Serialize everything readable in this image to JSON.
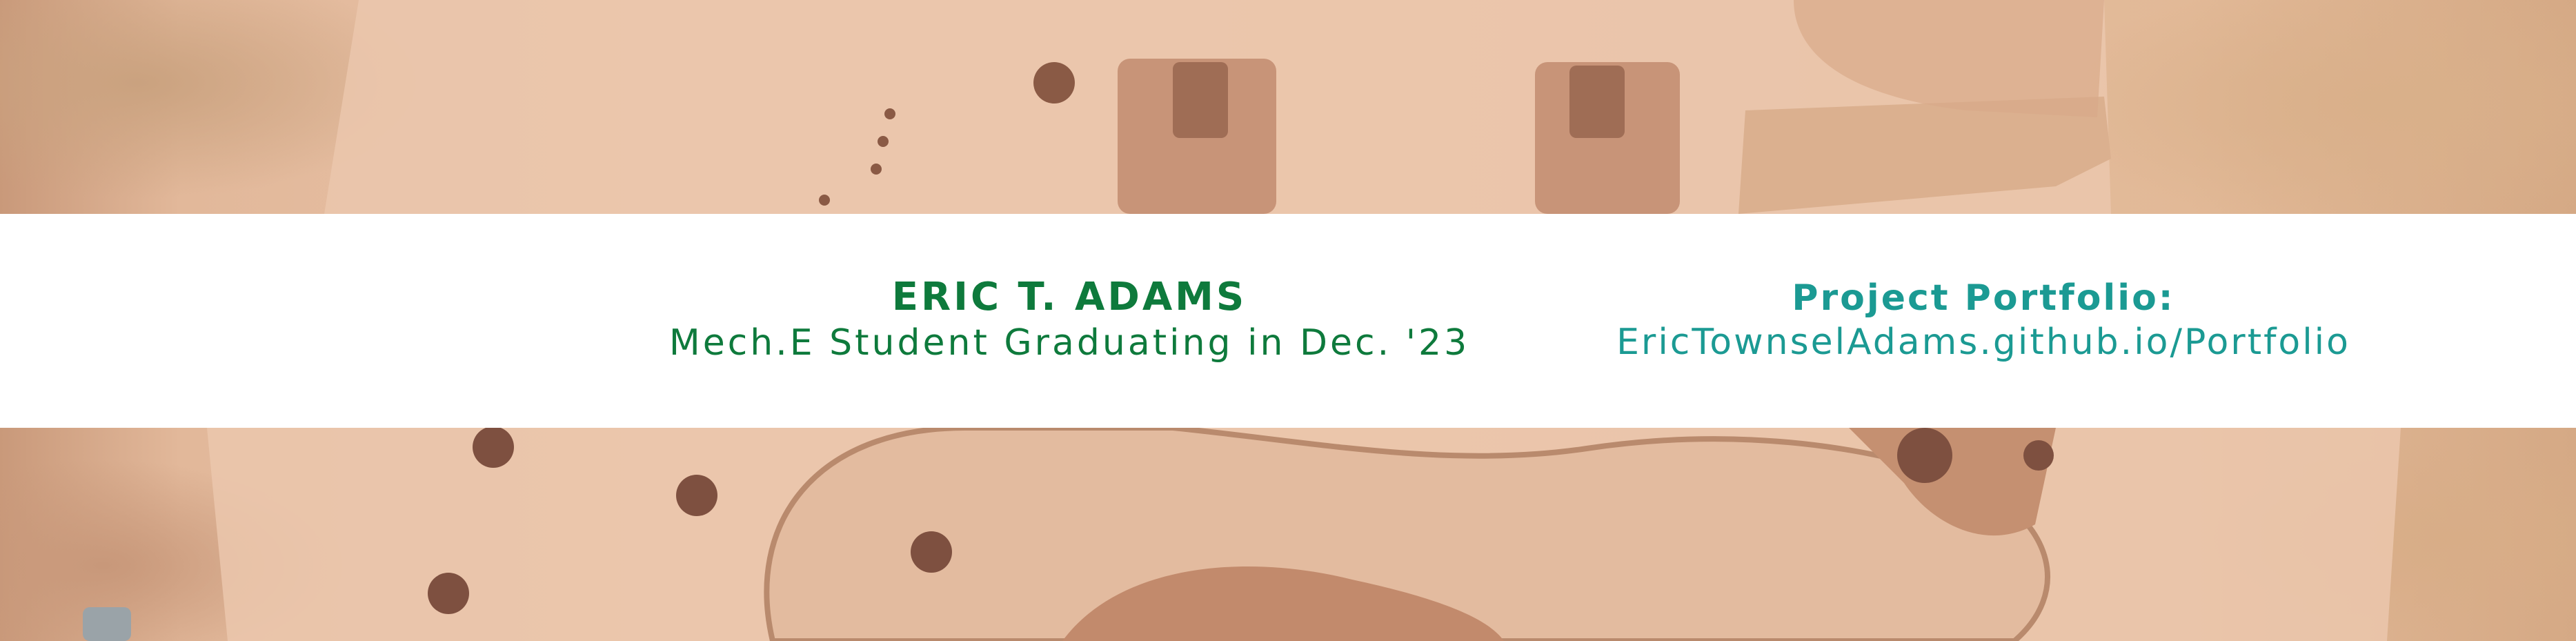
{
  "profile": {
    "name": "ERIC T. ADAMS",
    "subtitle": "Mech.E Student Graduating in Dec. '23"
  },
  "portfolio": {
    "label": "Project Portfolio:",
    "url_text": "EricTownselAdams.github.io/Portfolio"
  },
  "colors": {
    "name_green": "#0e7a3c",
    "portfolio_teal": "#1b9a93",
    "banner_white": "#ffffff",
    "wood": "#e6bea2",
    "sawdust": "#d5a985"
  },
  "background": {
    "subject": "cnc-machined-guitar-body-photo"
  }
}
